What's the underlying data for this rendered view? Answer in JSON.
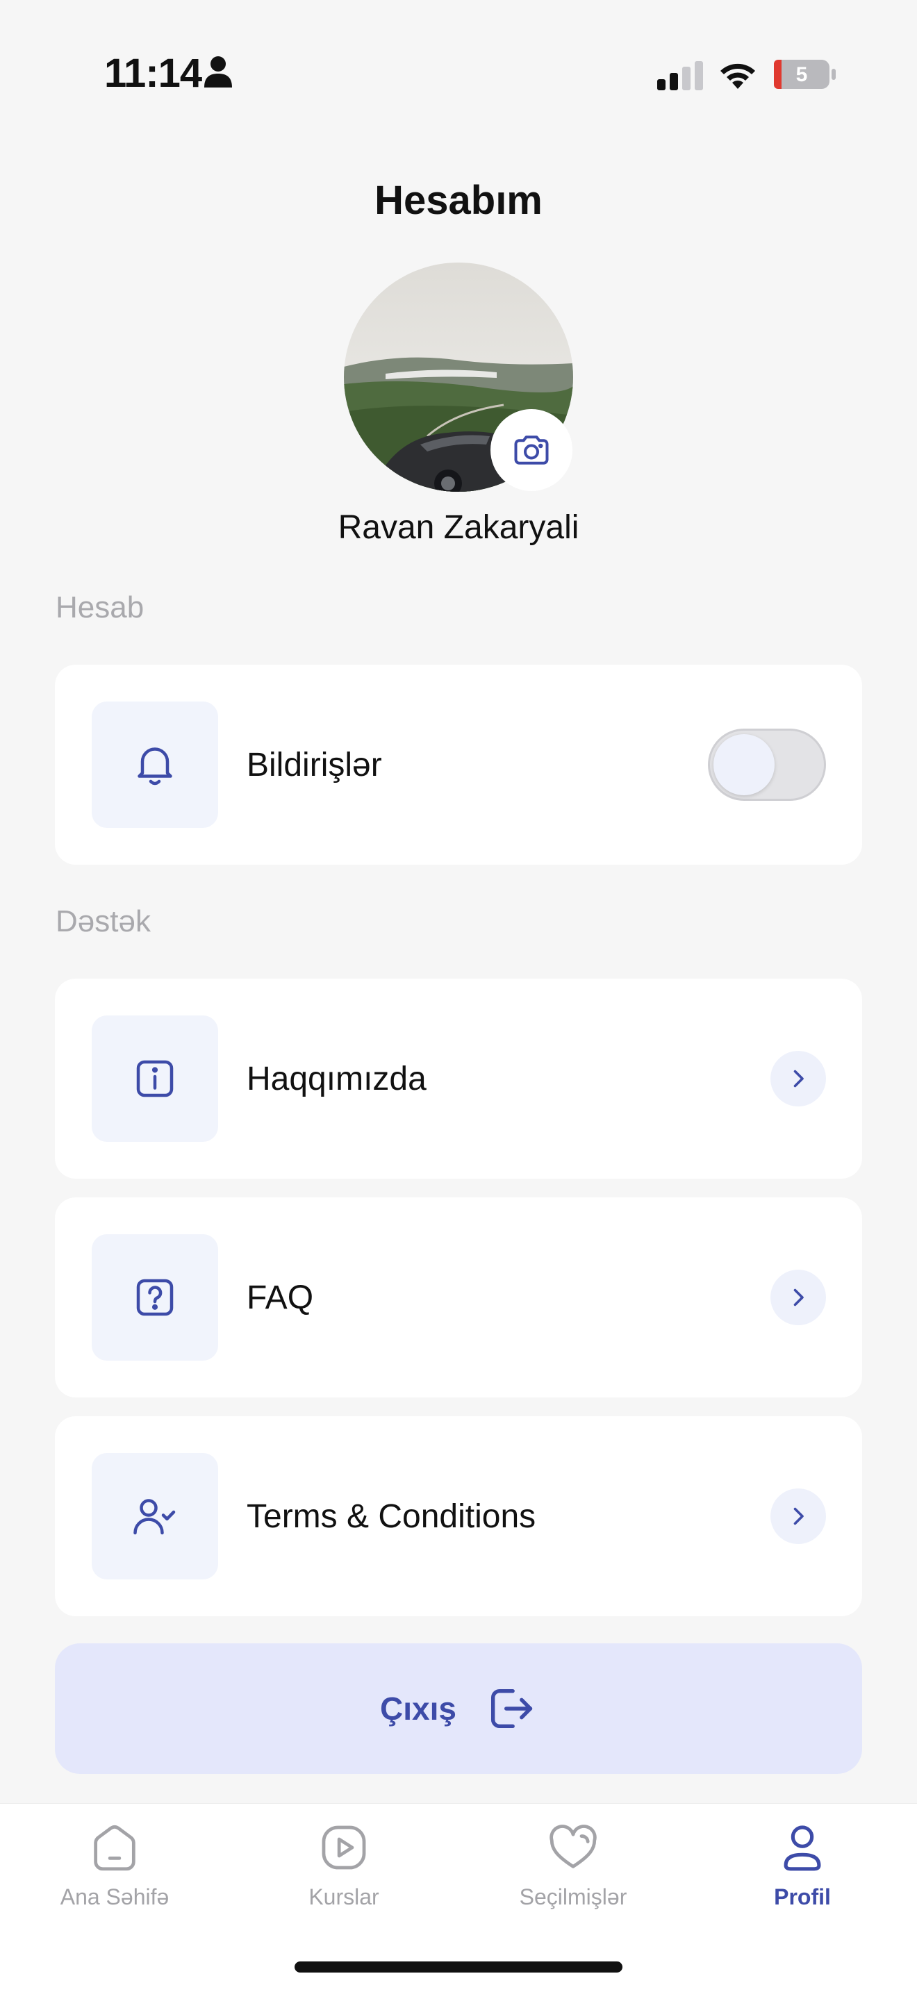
{
  "status_bar": {
    "time": "11:14",
    "battery_level": "5",
    "icons": [
      "person-icon",
      "signal-icon",
      "wifi-icon",
      "battery-icon"
    ]
  },
  "header": {
    "title": "Hesabım"
  },
  "profile": {
    "name": "Ravan Zakaryali",
    "avatar_icon": "car-landscape-photo",
    "edit_photo_icon": "camera-icon"
  },
  "sections": {
    "account_label": "Hesab",
    "support_label": "Dəstək"
  },
  "account_items": {
    "notifications": {
      "label": "Bildirişlər",
      "icon": "bell-icon",
      "toggle_on": false
    }
  },
  "support_items": {
    "about": {
      "label": "Haqqımızda",
      "icon": "info-icon"
    },
    "faq": {
      "label": "FAQ",
      "icon": "question-icon"
    },
    "terms": {
      "label": "Terms & Conditions",
      "icon": "user-check-icon"
    }
  },
  "logout": {
    "label": "Çıxış",
    "icon": "logout-icon"
  },
  "tab_bar": {
    "tabs": [
      {
        "label": "Ana Səhifə",
        "icon": "home-icon",
        "active": false
      },
      {
        "label": "Kurslar",
        "icon": "play-icon",
        "active": false
      },
      {
        "label": "Seçilmişlər",
        "icon": "heart-icon",
        "active": false
      },
      {
        "label": "Profil",
        "icon": "user-icon",
        "active": true
      }
    ]
  },
  "colors": {
    "accent": "#3d4ba8",
    "background": "#f6f6f6",
    "card": "#ffffff",
    "icon_tile": "#f1f4fc",
    "logout_bg": "#e4e7fb",
    "inactive": "#a3a3a7"
  }
}
